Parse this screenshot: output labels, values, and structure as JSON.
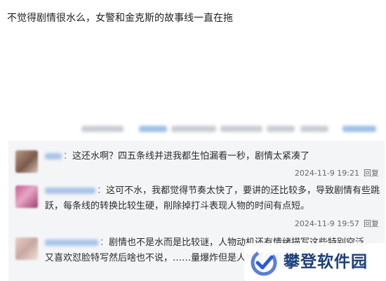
{
  "post": {
    "text": "不觉得剧情很水么，女警和金克斯的故事线一直在拖"
  },
  "comments": [
    {
      "name_suffix": "：",
      "text": "这还水啊？四五条线并进我都生怕漏看一秒，剧情太紧凑了",
      "time": "2024-11-9 19:21",
      "reply_label": "回复"
    },
    {
      "name_suffix": "：",
      "text": "这可不水，我都觉得节奏太快了，要讲的还比较多，导致剧情有些跳跃，每条线的转换比较生硬，削除掉打斗表现人物的时间有点短。",
      "time": "2024-11-9 19:57",
      "reply_label": "回复"
    },
    {
      "name_suffix": "：",
      "text": "剧情也不是水而是比较谜，人物动机还有情绪描写这些特别空泛，又喜欢怼脸特写然后啥也不说，……量爆炸但是人物情感跟不上的感觉",
      "time": "",
      "reply_label": ""
    }
  ],
  "watermark": {
    "text": "攀登软件园",
    "icon": "checkmark-logo-icon",
    "color": "#1c3f7a"
  }
}
